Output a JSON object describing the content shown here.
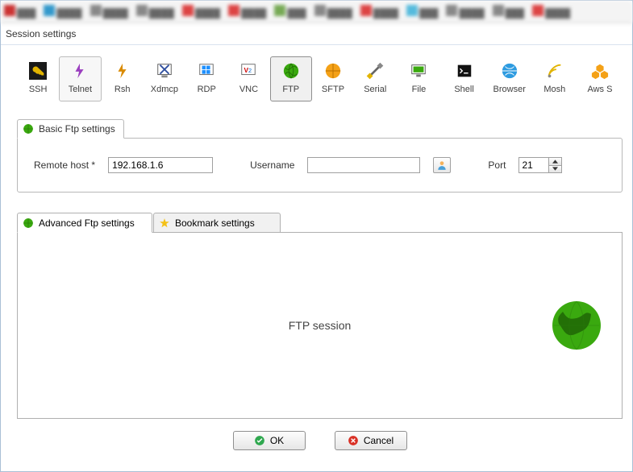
{
  "window": {
    "title": "Session settings"
  },
  "protocols": [
    {
      "id": "ssh",
      "label": "SSH"
    },
    {
      "id": "telnet",
      "label": "Telnet"
    },
    {
      "id": "rsh",
      "label": "Rsh"
    },
    {
      "id": "xdmcp",
      "label": "Xdmcp"
    },
    {
      "id": "rdp",
      "label": "RDP"
    },
    {
      "id": "vnc",
      "label": "VNC"
    },
    {
      "id": "ftp",
      "label": "FTP"
    },
    {
      "id": "sftp",
      "label": "SFTP"
    },
    {
      "id": "serial",
      "label": "Serial"
    },
    {
      "id": "file",
      "label": "File"
    },
    {
      "id": "shell",
      "label": "Shell"
    },
    {
      "id": "browser",
      "label": "Browser"
    },
    {
      "id": "mosh",
      "label": "Mosh"
    },
    {
      "id": "aws",
      "label": "Aws S"
    }
  ],
  "basic_tab": {
    "label": "Basic Ftp settings"
  },
  "fields": {
    "remote_host": {
      "label": "Remote host",
      "value": "192.168.1.6"
    },
    "username": {
      "label": "Username",
      "value": ""
    },
    "port": {
      "label": "Port",
      "value": "21"
    }
  },
  "lower_tabs": {
    "advanced": "Advanced Ftp settings",
    "bookmark": "Bookmark settings"
  },
  "session": {
    "title": "FTP session"
  },
  "buttons": {
    "ok": "OK",
    "cancel": "Cancel"
  },
  "icons": {
    "accent_green": "#3aa90f",
    "accent_orange": "#f4a117",
    "cancel_red": "#d93025",
    "ok_green": "#2fa84f"
  }
}
